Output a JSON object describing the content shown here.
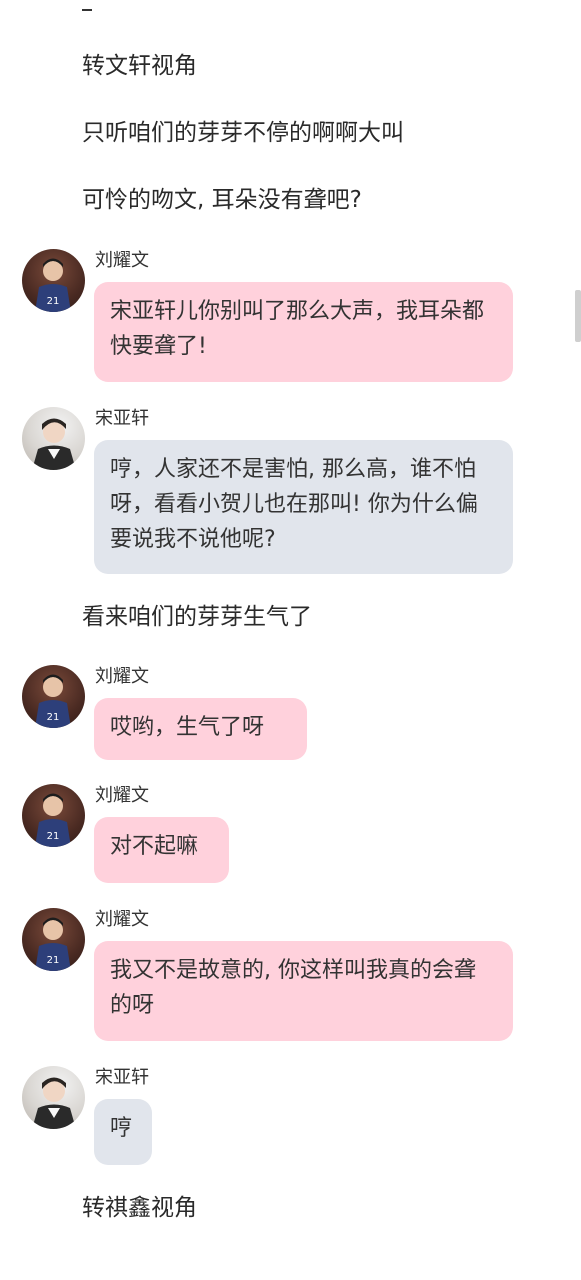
{
  "narration": {
    "n1": "转文轩视角",
    "n2": "只听咱们的芽芽不停的啊啊大叫",
    "n3": "可怜的吻文, 耳朵没有聋吧?",
    "n4": "看来咱们的芽芽生气了",
    "n5": "转祺鑫视角"
  },
  "messages": [
    {
      "sender": "刘耀文",
      "text": "宋亚轩儿你别叫了那么大声，我耳朵都快要聋了!"
    },
    {
      "sender": "宋亚轩",
      "text": "哼，人家还不是害怕, 那么高，谁不怕呀，看看小贺儿也在那叫! 你为什么偏要说我不说他呢?"
    },
    {
      "sender": "刘耀文",
      "text": "哎哟，生气了呀"
    },
    {
      "sender": "刘耀文",
      "text": "对不起嘛"
    },
    {
      "sender": "刘耀文",
      "text": "我又不是故意的, 你这样叫我真的会聋的呀"
    },
    {
      "sender": "宋亚轩",
      "text": "哼"
    }
  ],
  "colors": {
    "pink_bubble": "#ffd1dc",
    "grey_bubble": "#e1e5ec"
  },
  "icons": {
    "avatar_liu": "avatar-jersey-21",
    "avatar_song": "avatar-white-shirt"
  }
}
